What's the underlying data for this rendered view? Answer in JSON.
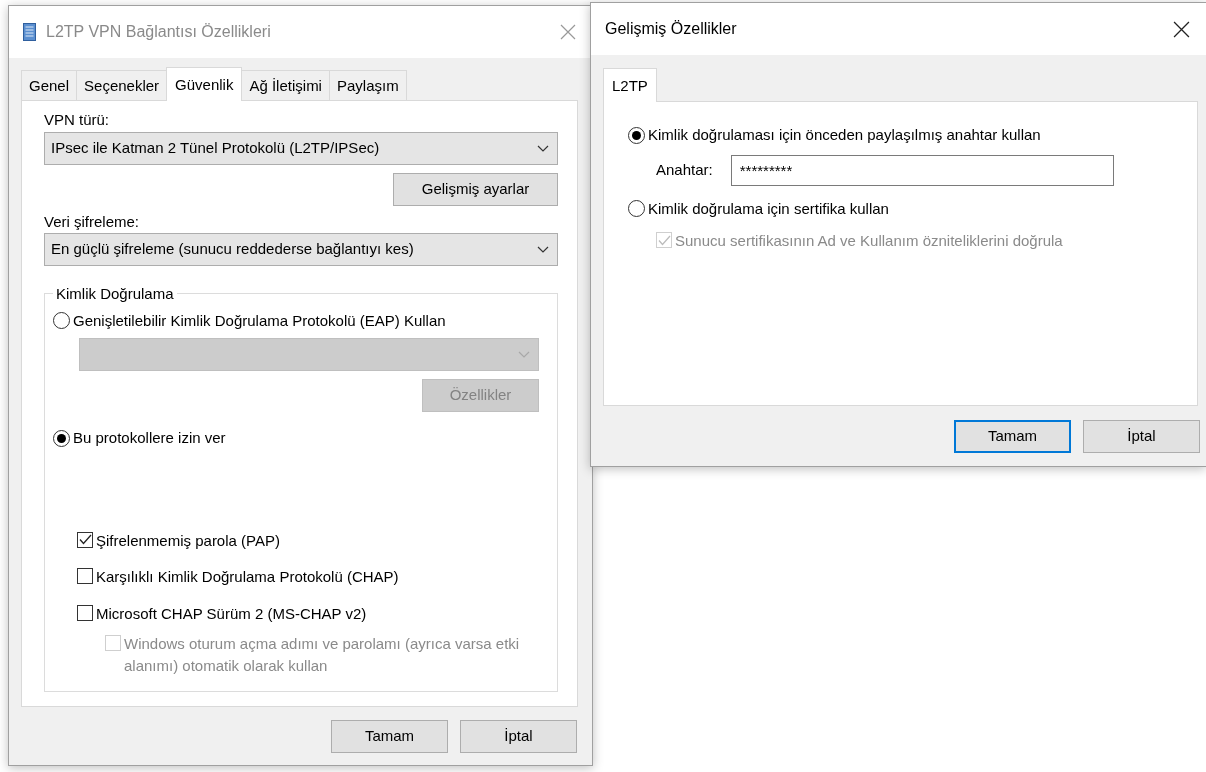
{
  "main_dialog": {
    "title": "L2TP VPN Bağlantısı Özellikleri",
    "tabs": [
      {
        "label": "Genel",
        "selected": false
      },
      {
        "label": "Seçenekler",
        "selected": false
      },
      {
        "label": "Güvenlik",
        "selected": true
      },
      {
        "label": "Ağ İletişimi",
        "selected": false
      },
      {
        "label": "Paylaşım",
        "selected": false
      }
    ],
    "vpn_type": {
      "label": "VPN türü:",
      "value": "IPsec ile Katman 2 Tünel Protokolü (L2TP/IPSec)"
    },
    "advanced_button": {
      "label": "Gelişmiş ayarlar"
    },
    "encryption": {
      "label": "Veri şifreleme:",
      "value": "En güçlü şifreleme (sunucu reddederse bağlantıyı kes)"
    },
    "authentication": {
      "title": "Kimlik Doğrulama",
      "eap": {
        "label": "Genişletilebilir Kimlik Doğrulama Protokolü (EAP) Kullan",
        "selected": false,
        "dropdown": {
          "disabled": true
        },
        "properties_button": {
          "label": "Özellikler",
          "disabled": true
        }
      },
      "protocols": {
        "label": "Bu protokollere izin ver",
        "selected": true,
        "checkboxes": [
          {
            "label": "Şifrelenmemiş parola (PAP)",
            "checked": true,
            "disabled": false
          },
          {
            "label": "Karşılıklı Kimlik Doğrulama Protokolü (CHAP)",
            "checked": false,
            "disabled": false
          },
          {
            "label": "Microsoft CHAP Sürüm 2 (MS-CHAP v2)",
            "checked": false,
            "disabled": false,
            "children": [
              {
                "label": "Windows oturum açma adımı ve parolamı (ayrıca varsa etki alanımı) otomatik olarak kullan",
                "checked": false,
                "disabled": true
              }
            ]
          }
        ]
      }
    },
    "buttons": [
      {
        "label": "Tamam",
        "default": false
      },
      {
        "label": "İptal",
        "default": false
      }
    ]
  },
  "advanced_dialog": {
    "title": "Gelişmiş Özellikler",
    "tabs": [
      {
        "label": "L2TP",
        "selected": true
      }
    ],
    "options": [
      {
        "label": "Kimlik doğrulaması için önceden paylaşılmış anahtar kullan",
        "selected": true,
        "key_field": {
          "label": "Anahtar:",
          "value": "*********"
        }
      },
      {
        "label": "Kimlik doğrulama için sertifika kullan",
        "selected": false,
        "checkboxes": [
          {
            "label": "Sunucu sertifikasının Ad ve Kullanım özniteliklerini doğrula",
            "checked": true,
            "disabled": true
          }
        ]
      }
    ],
    "buttons": [
      {
        "label": "Tamam",
        "default": true
      },
      {
        "label": "İptal",
        "default": false
      }
    ]
  }
}
